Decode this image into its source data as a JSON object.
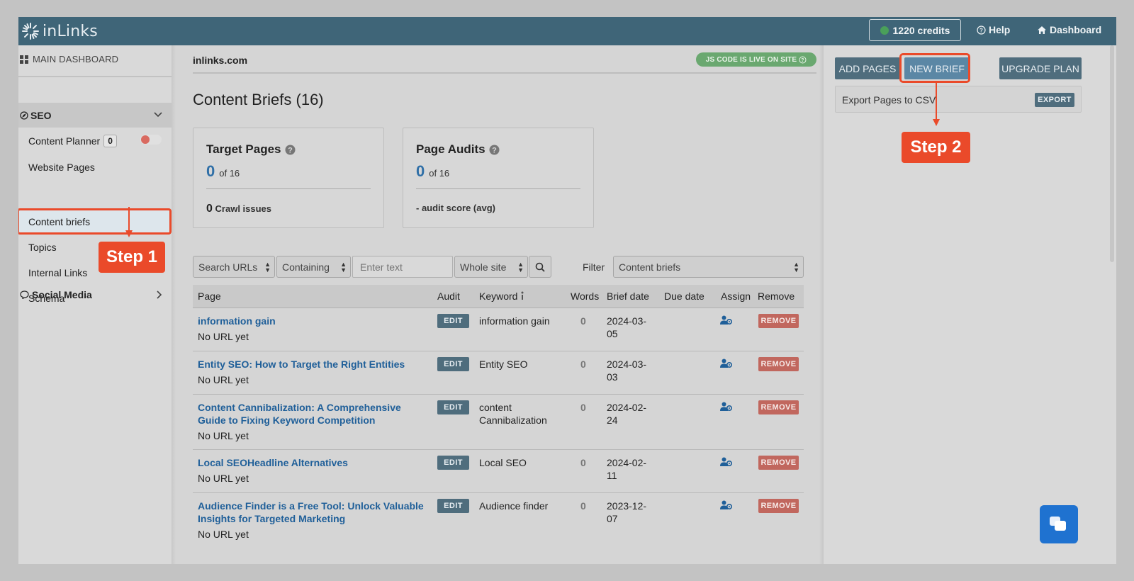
{
  "topbar": {
    "brand": "inLinks",
    "credits": "1220 credits",
    "help": "Help",
    "dashboard": "Dashboard"
  },
  "sidebar": {
    "main_dashboard": "MAIN DASHBOARD",
    "seo_section": "SEO",
    "items": [
      {
        "label": "Content Planner",
        "badge": "0"
      },
      {
        "label": "Website Pages"
      },
      {
        "label": "Content briefs"
      },
      {
        "label": "Topics"
      },
      {
        "label": "Internal Links"
      },
      {
        "label": "Schema"
      }
    ],
    "social_section": "Social Media"
  },
  "main": {
    "site": "inlinks.com",
    "js_status": "JS CODE IS LIVE ON SITE",
    "title": "Content Briefs (16)",
    "cards": {
      "target": {
        "title": "Target Pages",
        "count": "0",
        "of": "of 16",
        "foot_num": "0",
        "foot_text": "Crawl issues"
      },
      "audits": {
        "title": "Page Audits",
        "count": "0",
        "of": "of 16",
        "foot_text": "- audit score (avg)"
      }
    },
    "filters": {
      "search_type": "Search URLs",
      "match": "Containing",
      "text_placeholder": "Enter text",
      "scope": "Whole site",
      "filter_label": "Filter",
      "filter_value": "Content briefs"
    },
    "table": {
      "headers": {
        "page": "Page",
        "audit": "Audit",
        "keyword": "Keyword",
        "words": "Words",
        "brief_date": "Brief date",
        "due_date": "Due date",
        "assign": "Assign",
        "remove": "Remove"
      },
      "edit_label": "EDIT",
      "remove_label": "REMOVE",
      "rows": [
        {
          "title": "information gain",
          "url": "No URL yet",
          "keyword": "information gain",
          "words": "0",
          "brief_date": "2024-03-05"
        },
        {
          "title": "Entity SEO: How to Target the Right Entities",
          "url": "No URL yet",
          "keyword": "Entity SEO",
          "words": "0",
          "brief_date": "2024-03-03"
        },
        {
          "title": "Content Cannibalization: A Comprehensive Guide to Fixing Keyword Competition",
          "url": "No URL yet",
          "keyword": "content Cannibalization",
          "words": "0",
          "brief_date": "2024-02-24"
        },
        {
          "title": "Local SEOHeadline Alternatives",
          "url": "No URL yet",
          "keyword": "Local SEO",
          "words": "0",
          "brief_date": "2024-02-11"
        },
        {
          "title": "Audience Finder is a Free Tool: Unlock Valuable Insights for Targeted Marketing",
          "url": "No URL yet",
          "keyword": "Audience finder",
          "words": "0",
          "brief_date": "2023-12-07"
        }
      ]
    }
  },
  "panel": {
    "add_pages": "ADD PAGES",
    "new_brief": "NEW BRIEF",
    "upgrade": "UPGRADE PLAN",
    "export_label": "Export Pages to CSV",
    "export_button": "EXPORT"
  },
  "annotations": {
    "step1": "Step 1",
    "step2": "Step 2"
  },
  "colors": {
    "topbar": "#3f6578",
    "accent_highlight": "#ea4a2a",
    "link": "#1f5f99",
    "edit_button": "#4f6d7d",
    "remove_button": "#c1675e",
    "live_badge": "#6aa870"
  }
}
